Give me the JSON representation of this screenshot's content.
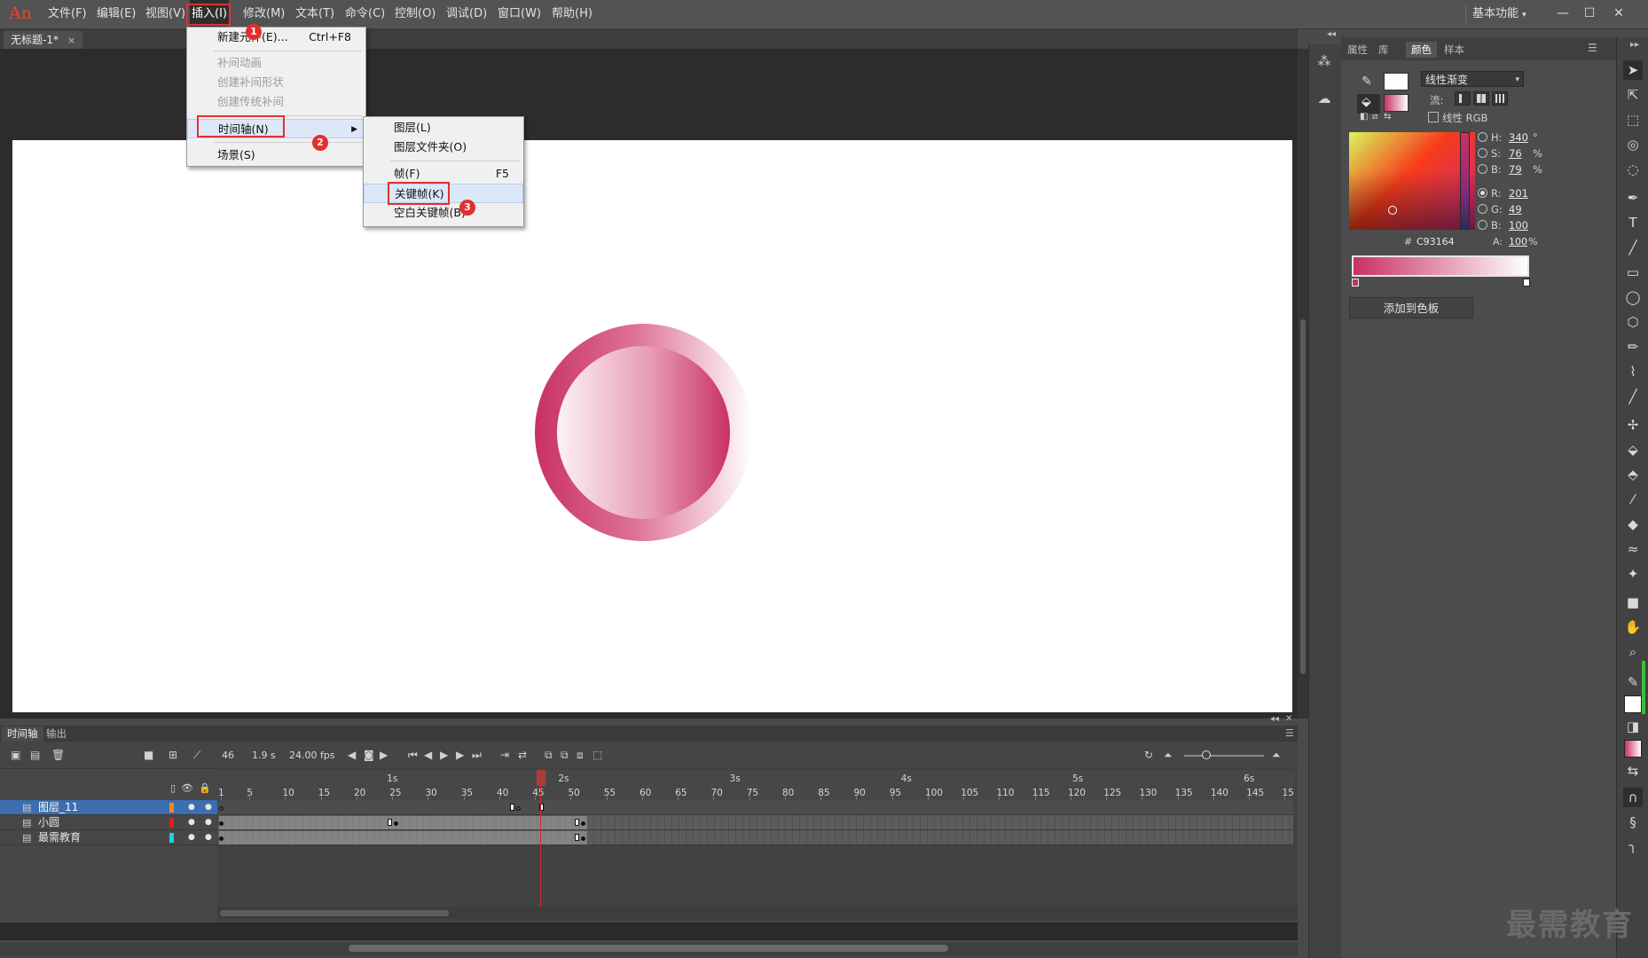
{
  "app": {
    "logo": "An"
  },
  "menubar": {
    "items": [
      {
        "label": "文件(F)"
      },
      {
        "label": "编辑(E)"
      },
      {
        "label": "视图(V)"
      },
      {
        "label": "插入(I)"
      },
      {
        "label": "修改(M)"
      },
      {
        "label": "文本(T)"
      },
      {
        "label": "命令(C)"
      },
      {
        "label": "控制(O)"
      },
      {
        "label": "调试(D)"
      },
      {
        "label": "窗口(W)"
      },
      {
        "label": "帮助(H)"
      }
    ],
    "workspace": "基本功能",
    "window_controls": {
      "minimize": "—",
      "maximize": "☐",
      "close": "✕"
    }
  },
  "document_tab": {
    "title": "无标题-1*",
    "close": "×"
  },
  "insert_menu": {
    "items": [
      {
        "label": "新建元件(E)...",
        "shortcut": "Ctrl+F8"
      },
      {
        "label": "补间动画"
      },
      {
        "label": "创建补间形状"
      },
      {
        "label": "创建传统补间"
      },
      {
        "label": "时间轴(N)"
      },
      {
        "label": "场景(S)"
      }
    ]
  },
  "timeline_submenu": {
    "items": [
      {
        "label": "图层(L)"
      },
      {
        "label": "图层文件夹(O)"
      },
      {
        "label": "帧(F)",
        "shortcut": "F5"
      },
      {
        "label": "关键帧(K)"
      },
      {
        "label": "空白关键帧(B)"
      }
    ]
  },
  "steps": [
    "1",
    "2",
    "3"
  ],
  "color_panel": {
    "tabs": [
      {
        "label": "属性"
      },
      {
        "label": "库"
      },
      {
        "label": "颜色"
      },
      {
        "label": "样本"
      }
    ],
    "gradient_type": "线性渐变",
    "flow_label": "流:",
    "linear_rgb_label": "线性 RGB",
    "hsb": [
      {
        "label": "H:",
        "value": "340",
        "unit": "°"
      },
      {
        "label": "S:",
        "value": "76",
        "unit": "%"
      },
      {
        "label": "B:",
        "value": "79",
        "unit": "%"
      }
    ],
    "rgb": [
      {
        "label": "R:",
        "value": "201"
      },
      {
        "label": "G:",
        "value": "49"
      },
      {
        "label": "B:",
        "value": "100"
      }
    ],
    "hex_label": "#",
    "hex": "C93164",
    "alpha_label": "A:",
    "alpha": "100",
    "alpha_unit": "%",
    "add_swatch": "添加到色板",
    "gradient_colors": [
      "#c93164",
      "#ffffff"
    ]
  },
  "timeline": {
    "tabs": [
      {
        "label": "时间轴"
      },
      {
        "label": "输出"
      }
    ],
    "current_frame": "46",
    "elapsed": "1.9 s",
    "fps": "24.00 fps",
    "ruler_seconds": [
      "1s",
      "2s",
      "3s",
      "4s",
      "5s",
      "6s"
    ],
    "ruler_frames": [
      "1",
      "5",
      "10",
      "15",
      "20",
      "25",
      "30",
      "35",
      "40",
      "45",
      "50",
      "55",
      "60",
      "65",
      "70",
      "75",
      "80",
      "85",
      "90",
      "95",
      "100",
      "105",
      "110",
      "115",
      "120",
      "125",
      "130",
      "135",
      "140",
      "145",
      "15"
    ],
    "layers": [
      {
        "name": "图层_11",
        "color": "#f28a1f"
      },
      {
        "name": "小圆",
        "color": "#e02020"
      },
      {
        "name": "最需教育",
        "color": "#19d5e6"
      }
    ]
  },
  "watermark": "最需教育"
}
